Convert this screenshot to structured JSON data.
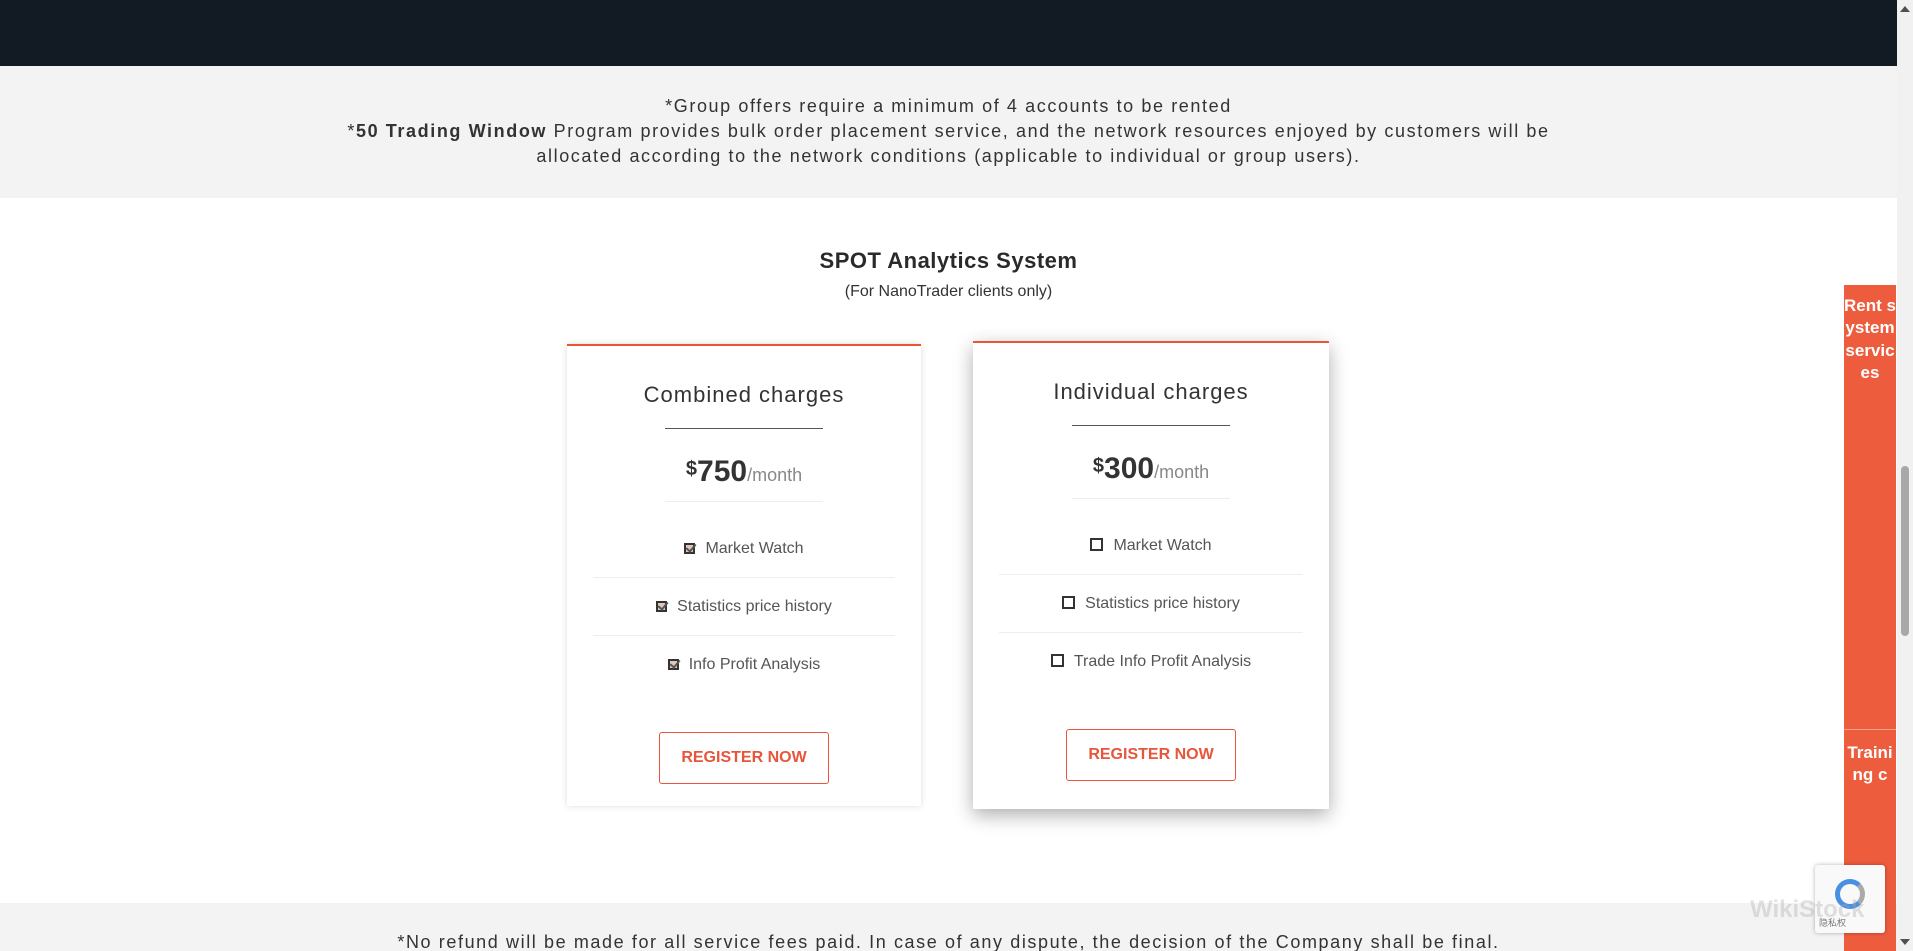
{
  "notice": {
    "line1": "*Group offers require a minimum of 4 accounts to be rented",
    "line2_prefix": "*",
    "line2_bold": "50 Trading Window",
    "line2_rest": " Program provides bulk order placement service, and the network resources enjoyed by customers will be",
    "line3": "allocated according to the network conditions (applicable to individual or group users)."
  },
  "section": {
    "title": "SPOT Analytics System",
    "subtitle": "(For NanoTrader clients only)"
  },
  "plans": [
    {
      "name": "Combined charges",
      "currency": "$",
      "amount": "750",
      "period": "/month",
      "features": [
        {
          "label": "Market Watch",
          "checked": true
        },
        {
          "label": "Statistics price history",
          "checked": true
        },
        {
          "label": "Info Profit Analysis",
          "checked": true
        }
      ],
      "button": "REGISTER NOW"
    },
    {
      "name": "Individual charges",
      "currency": "$",
      "amount": "300",
      "period": "/month",
      "features": [
        {
          "label": "Market Watch",
          "checked": false
        },
        {
          "label": "Statistics price history",
          "checked": false
        },
        {
          "label": "Trade Info Profit Analysis",
          "checked": false
        }
      ],
      "button": "REGISTER NOW"
    }
  ],
  "footer": {
    "disclaimer": "*No refund will be made for all service fees paid. In case of any dispute, the decision of the Company shall be final."
  },
  "side_tab": {
    "label1": "Rent system services",
    "label2": "Training c"
  },
  "recaptcha": {
    "text": "隐私权"
  },
  "watermark": "WikiStock",
  "colors": {
    "accent": "#e8553b",
    "side_tab": "#ee5c3e",
    "topbar": "#121a24",
    "band": "#f3f3f3"
  }
}
